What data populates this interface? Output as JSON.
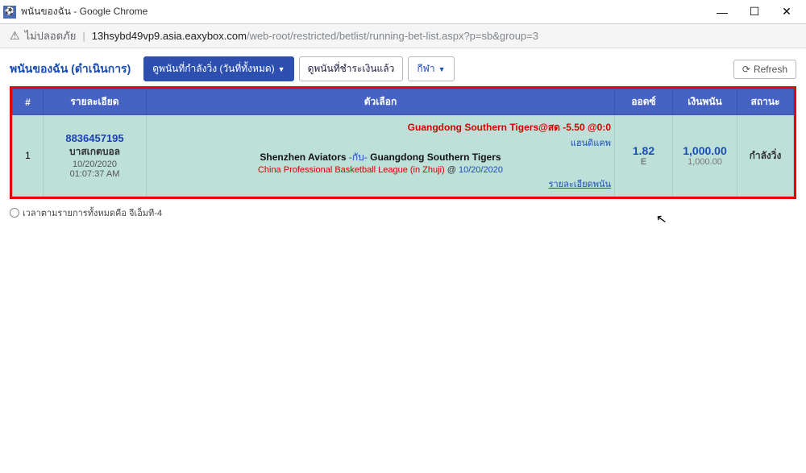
{
  "window": {
    "title": "พนันของฉัน - Google Chrome",
    "min_label": "—",
    "max_label": "☐",
    "close_label": "✕"
  },
  "addressbar": {
    "insecure_label": "ไม่ปลอดภัย",
    "url_host": "13hsybd49vp9.asia.eaxybox.com",
    "url_path": "/web-root/restricted/betlist/running-bet-list.aspx?p=sb&group=3"
  },
  "tabs": {
    "page_title": "พนันของฉัน (ดำเนินการ)",
    "active_running": "ดูพนันที่กำลังวิ่ง (วันที่ทั้งหมด)",
    "settled": "ดูพนันที่ชำระเงินแล้ว",
    "sport": "กีฬา",
    "refresh": "Refresh"
  },
  "table": {
    "headers": {
      "num": "#",
      "detail": "รายละเอียด",
      "selection": "ตัวเลือก",
      "odds": "ออดซ์",
      "stake": "เงินพนัน",
      "status": "สถานะ"
    },
    "row": {
      "num": "1",
      "bet_id": "8836457195",
      "sport": "บาสเกตบอล",
      "date": "10/20/2020",
      "time": "01:07:37 AM",
      "pick": "Guangdong Southern Tigers@สด -5.50 @0:0",
      "bet_type": "แฮนดิแคพ",
      "team_a": "Shenzhen Aviators",
      "vs": " -กับ- ",
      "team_b": "Guangdong Southern Tigers",
      "league": "China Professional Basketball League (in Zhuji)",
      "at_sym": "@",
      "event_date": "10/20/2020",
      "detail_link": "รายละเอียดพนัน",
      "odds": "1.82",
      "odds_type": "E",
      "stake": "1,000.00",
      "stake_sub": "1,000.00",
      "status": "กำลังวิ่ง"
    }
  },
  "footer": {
    "note": "เวลาตามรายการทั้งหมดคือ จีเอ็มที-4"
  }
}
